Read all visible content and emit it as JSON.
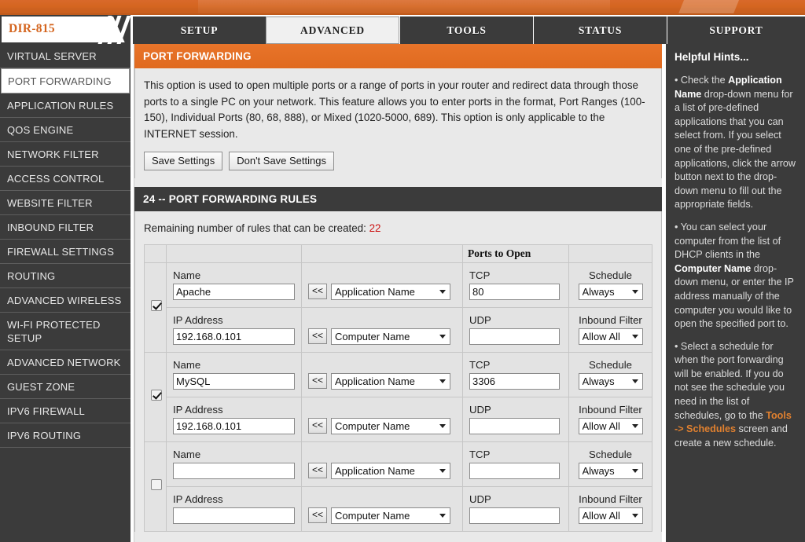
{
  "brand": {
    "model": "DIR-815"
  },
  "nav": {
    "tabs": [
      {
        "label": "SETUP",
        "active": false
      },
      {
        "label": "ADVANCED",
        "active": true
      },
      {
        "label": "TOOLS",
        "active": false
      },
      {
        "label": "STATUS",
        "active": false
      },
      {
        "label": "SUPPORT",
        "active": false
      }
    ]
  },
  "sidebar": {
    "items": [
      {
        "label": "VIRTUAL SERVER",
        "active": false
      },
      {
        "label": "PORT FORWARDING",
        "active": true
      },
      {
        "label": "APPLICATION RULES",
        "active": false
      },
      {
        "label": "QOS ENGINE",
        "active": false
      },
      {
        "label": "NETWORK FILTER",
        "active": false
      },
      {
        "label": "ACCESS CONTROL",
        "active": false
      },
      {
        "label": "WEBSITE FILTER",
        "active": false
      },
      {
        "label": "INBOUND FILTER",
        "active": false
      },
      {
        "label": "FIREWALL SETTINGS",
        "active": false
      },
      {
        "label": "ROUTING",
        "active": false
      },
      {
        "label": "ADVANCED WIRELESS",
        "active": false
      },
      {
        "label": "WI-FI PROTECTED SETUP",
        "active": false
      },
      {
        "label": "ADVANCED NETWORK",
        "active": false
      },
      {
        "label": "GUEST ZONE",
        "active": false
      },
      {
        "label": "IPV6 FIREWALL",
        "active": false
      },
      {
        "label": "IPV6 ROUTING",
        "active": false
      }
    ]
  },
  "panel": {
    "title": "PORT FORWARDING",
    "description": "This option is used to open multiple ports or a range of ports in your router and redirect data through those ports to a single PC on your network. This feature allows you to enter ports in the format, Port Ranges (100-150), Individual Ports (80, 68, 888), or Mixed (1020-5000, 689). This option is only applicable to the INTERNET session.",
    "save_label": "Save Settings",
    "dont_save_label": "Don't Save Settings"
  },
  "rules": {
    "section_title": "24 -- PORT FORWARDING RULES",
    "remaining_text": "Remaining number of rules that can be created:",
    "remaining_count": "22",
    "headers": {
      "ports_to_open": "Ports to Open"
    },
    "labels": {
      "name": "Name",
      "ip_address": "IP Address",
      "tcp": "TCP",
      "udp": "UDP",
      "schedule": "Schedule",
      "inbound_filter": "Inbound Filter",
      "arrow": "<<"
    },
    "options": {
      "application_name": "Application Name",
      "computer_name": "Computer Name",
      "schedule": "Always",
      "inbound_filter": "Allow All"
    },
    "rows": [
      {
        "enabled": true,
        "name": "Apache",
        "ip_address": "192.168.0.101",
        "tcp": "80",
        "udp": "",
        "app_name": "Application Name",
        "computer_name": "Computer Name",
        "schedule": "Always",
        "inbound_filter": "Allow All"
      },
      {
        "enabled": true,
        "name": "MySQL",
        "ip_address": "192.168.0.101",
        "tcp": "3306",
        "udp": "",
        "app_name": "Application Name",
        "computer_name": "Computer Name",
        "schedule": "Always",
        "inbound_filter": "Allow All"
      },
      {
        "enabled": false,
        "name": "",
        "ip_address": "",
        "tcp": "",
        "udp": "",
        "app_name": "Application Name",
        "computer_name": "Computer Name",
        "schedule": "Always",
        "inbound_filter": "Allow All"
      }
    ]
  },
  "hints": {
    "title": "Helpful Hints...",
    "items": [
      {
        "pre": "Check the ",
        "bold": "Application Name",
        "post": " drop-down menu for a list of pre-defined applications that you can select from. If you select one of the pre-defined applications, click the arrow button next to the drop-down menu to fill out the appropriate fields."
      },
      {
        "pre": "You can select your computer from the list of DHCP clients in the ",
        "bold": "Computer Name",
        "post": " drop-down menu, or enter the IP address manually of the computer you would like to open the specified port to."
      },
      {
        "pre": "Select a schedule for when the port forwarding will be enabled. If you do not see the schedule you need in the list of schedules, go to the ",
        "link": "Tools -> Schedules",
        "post": " screen and create a new schedule."
      }
    ]
  },
  "colors": {
    "orange": "#d4651f",
    "panel_header_orange": "#e06a1f",
    "dark": "#3b3b3b",
    "red_count": "#cc1111",
    "hint_link": "#e0802f"
  }
}
